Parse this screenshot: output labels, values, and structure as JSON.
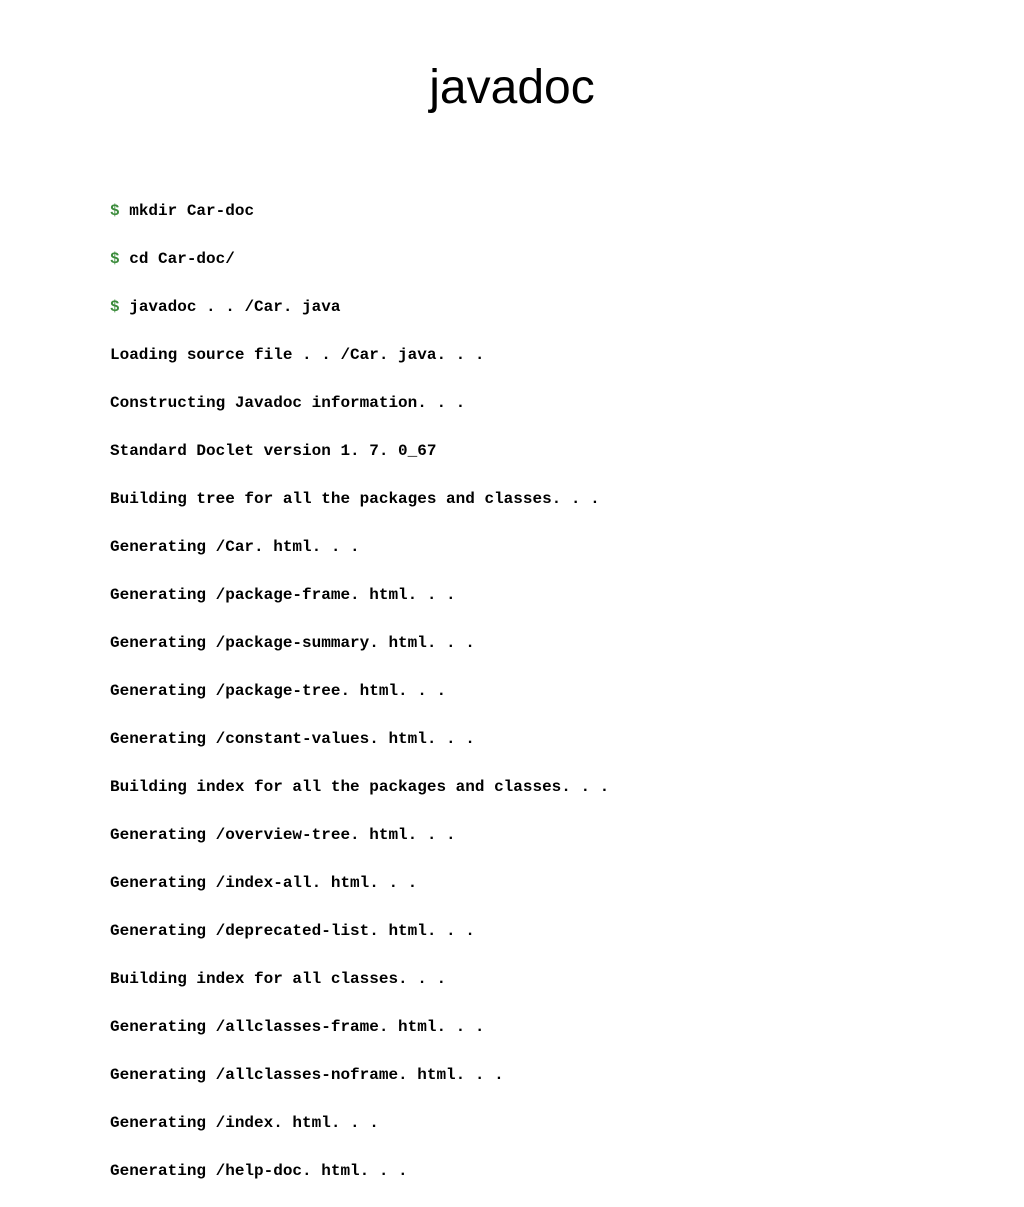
{
  "title": "javadoc",
  "prompt": "$",
  "commands": [
    "mkdir Car-doc",
    "cd Car-doc/",
    "javadoc . . /Car. java"
  ],
  "output": [
    "Loading source file . . /Car. java. . .",
    "Constructing Javadoc information. . .",
    "Standard Doclet version 1. 7. 0_67",
    "Building tree for all the packages and classes. . .",
    "Generating /Car. html. . .",
    "Generating /package-frame. html. . .",
    "Generating /package-summary. html. . .",
    "Generating /package-tree. html. . .",
    "Generating /constant-values. html. . .",
    "Building index for all the packages and classes. . .",
    "Generating /overview-tree. html. . .",
    "Generating /index-all. html. . .",
    "Generating /deprecated-list. html. . .",
    "Building index for all classes. . .",
    "Generating /allclasses-frame. html. . .",
    "Generating /allclasses-noframe. html. . .",
    "Generating /index. html. . .",
    "Generating /help-doc. html. . ."
  ]
}
